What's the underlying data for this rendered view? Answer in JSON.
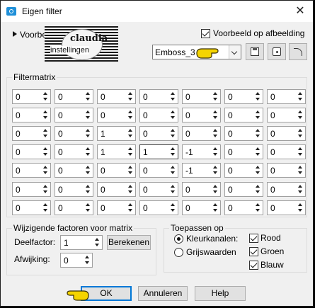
{
  "window": {
    "title": "Eigen filter",
    "close_glyph": "✕"
  },
  "preview": {
    "label": "Voorbeeld",
    "preview_checkbox_label": "Voorbeeld op afbeelding",
    "preview_checked": true,
    "watermark_line1": "claudia",
    "watermark_line2": "instellingen"
  },
  "preset": {
    "value": "Emboss_3"
  },
  "filtermatrix": {
    "title": "Filtermatrix",
    "rows": [
      [
        "0",
        "0",
        "0",
        "0",
        "0",
        "0",
        "0"
      ],
      [
        "0",
        "0",
        "0",
        "0",
        "0",
        "0",
        "0"
      ],
      [
        "0",
        "0",
        "1",
        "0",
        "0",
        "0",
        "0"
      ],
      [
        "0",
        "0",
        "1",
        "1",
        "-1",
        "0",
        "0"
      ],
      [
        "0",
        "0",
        "0",
        "0",
        "-1",
        "0",
        "0"
      ],
      [
        "0",
        "0",
        "0",
        "0",
        "0",
        "0",
        "0"
      ],
      [
        "0",
        "0",
        "0",
        "0",
        "0",
        "0",
        "0"
      ]
    ]
  },
  "factors": {
    "title": "Wijzigende factoren voor matrix",
    "divisor_label": "Deelfactor:",
    "divisor_value": "1",
    "calculate_button": "Berekenen",
    "bias_label": "Afwijking:",
    "bias_value": "0"
  },
  "apply": {
    "title": "Toepassen op",
    "color_channels_label": "Kleurkanalen:",
    "grayscale_label": "Grijswaarden",
    "selected": "Kleurkanalen:",
    "red_label": "Rood",
    "green_label": "Groen",
    "blue_label": "Blauw",
    "red_checked": true,
    "green_checked": true,
    "blue_checked": true
  },
  "buttons": {
    "ok": "OK",
    "cancel": "Annuleren",
    "help": "Help"
  },
  "colors": {
    "pointer_fill": "#f5d400",
    "pointer_outline": "#3a3000",
    "ok_border": "#0078d7"
  }
}
